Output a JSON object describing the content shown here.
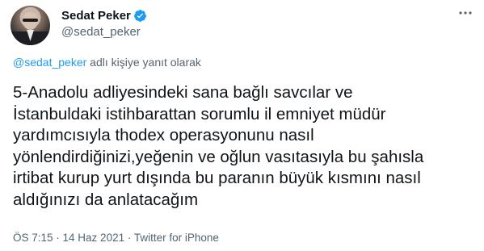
{
  "author": {
    "display_name": "Sedat Peker",
    "handle": "@sedat_peker"
  },
  "reply": {
    "mention": "@sedat_peker",
    "suffix": " adlı kişiye yanıt olarak"
  },
  "tweet_text": "5-Anadolu adliyesindeki sana bağlı savcılar ve\nİstanbuldaki istihbarattan sorumlu il emniyet müdür\nyardımcısıyla thodex operasyonunu nasıl\nyönlendirdiğinizi,yeğenin ve oğlun vasıtasıyla bu şahısla\nirtibat kurup yurt dışında bu paranın büyük kısmını nasıl\naldığınızı da anlatacağım",
  "meta": {
    "time": "ÖS 7:15",
    "separator": " · ",
    "date": "14 Haz 2021",
    "source": "Twitter for iPhone"
  },
  "colors": {
    "text": "#0f1419",
    "secondary": "#536471",
    "link": "#1d9bf0"
  },
  "icons": [
    "verified-badge-icon",
    "more-options-icon"
  ]
}
